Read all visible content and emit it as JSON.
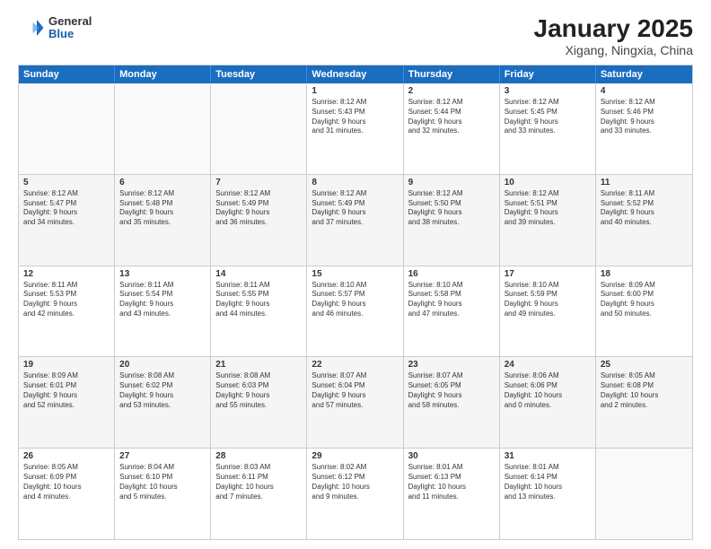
{
  "logo": {
    "general": "General",
    "blue": "Blue"
  },
  "title": "January 2025",
  "subtitle": "Xigang, Ningxia, China",
  "header_days": [
    "Sunday",
    "Monday",
    "Tuesday",
    "Wednesday",
    "Thursday",
    "Friday",
    "Saturday"
  ],
  "weeks": [
    {
      "alt": false,
      "days": [
        {
          "num": "",
          "info": ""
        },
        {
          "num": "",
          "info": ""
        },
        {
          "num": "",
          "info": ""
        },
        {
          "num": "1",
          "info": "Sunrise: 8:12 AM\nSunset: 5:43 PM\nDaylight: 9 hours\nand 31 minutes."
        },
        {
          "num": "2",
          "info": "Sunrise: 8:12 AM\nSunset: 5:44 PM\nDaylight: 9 hours\nand 32 minutes."
        },
        {
          "num": "3",
          "info": "Sunrise: 8:12 AM\nSunset: 5:45 PM\nDaylight: 9 hours\nand 33 minutes."
        },
        {
          "num": "4",
          "info": "Sunrise: 8:12 AM\nSunset: 5:46 PM\nDaylight: 9 hours\nand 33 minutes."
        }
      ]
    },
    {
      "alt": true,
      "days": [
        {
          "num": "5",
          "info": "Sunrise: 8:12 AM\nSunset: 5:47 PM\nDaylight: 9 hours\nand 34 minutes."
        },
        {
          "num": "6",
          "info": "Sunrise: 8:12 AM\nSunset: 5:48 PM\nDaylight: 9 hours\nand 35 minutes."
        },
        {
          "num": "7",
          "info": "Sunrise: 8:12 AM\nSunset: 5:49 PM\nDaylight: 9 hours\nand 36 minutes."
        },
        {
          "num": "8",
          "info": "Sunrise: 8:12 AM\nSunset: 5:49 PM\nDaylight: 9 hours\nand 37 minutes."
        },
        {
          "num": "9",
          "info": "Sunrise: 8:12 AM\nSunset: 5:50 PM\nDaylight: 9 hours\nand 38 minutes."
        },
        {
          "num": "10",
          "info": "Sunrise: 8:12 AM\nSunset: 5:51 PM\nDaylight: 9 hours\nand 39 minutes."
        },
        {
          "num": "11",
          "info": "Sunrise: 8:11 AM\nSunset: 5:52 PM\nDaylight: 9 hours\nand 40 minutes."
        }
      ]
    },
    {
      "alt": false,
      "days": [
        {
          "num": "12",
          "info": "Sunrise: 8:11 AM\nSunset: 5:53 PM\nDaylight: 9 hours\nand 42 minutes."
        },
        {
          "num": "13",
          "info": "Sunrise: 8:11 AM\nSunset: 5:54 PM\nDaylight: 9 hours\nand 43 minutes."
        },
        {
          "num": "14",
          "info": "Sunrise: 8:11 AM\nSunset: 5:55 PM\nDaylight: 9 hours\nand 44 minutes."
        },
        {
          "num": "15",
          "info": "Sunrise: 8:10 AM\nSunset: 5:57 PM\nDaylight: 9 hours\nand 46 minutes."
        },
        {
          "num": "16",
          "info": "Sunrise: 8:10 AM\nSunset: 5:58 PM\nDaylight: 9 hours\nand 47 minutes."
        },
        {
          "num": "17",
          "info": "Sunrise: 8:10 AM\nSunset: 5:59 PM\nDaylight: 9 hours\nand 49 minutes."
        },
        {
          "num": "18",
          "info": "Sunrise: 8:09 AM\nSunset: 6:00 PM\nDaylight: 9 hours\nand 50 minutes."
        }
      ]
    },
    {
      "alt": true,
      "days": [
        {
          "num": "19",
          "info": "Sunrise: 8:09 AM\nSunset: 6:01 PM\nDaylight: 9 hours\nand 52 minutes."
        },
        {
          "num": "20",
          "info": "Sunrise: 8:08 AM\nSunset: 6:02 PM\nDaylight: 9 hours\nand 53 minutes."
        },
        {
          "num": "21",
          "info": "Sunrise: 8:08 AM\nSunset: 6:03 PM\nDaylight: 9 hours\nand 55 minutes."
        },
        {
          "num": "22",
          "info": "Sunrise: 8:07 AM\nSunset: 6:04 PM\nDaylight: 9 hours\nand 57 minutes."
        },
        {
          "num": "23",
          "info": "Sunrise: 8:07 AM\nSunset: 6:05 PM\nDaylight: 9 hours\nand 58 minutes."
        },
        {
          "num": "24",
          "info": "Sunrise: 8:06 AM\nSunset: 6:06 PM\nDaylight: 10 hours\nand 0 minutes."
        },
        {
          "num": "25",
          "info": "Sunrise: 8:05 AM\nSunset: 6:08 PM\nDaylight: 10 hours\nand 2 minutes."
        }
      ]
    },
    {
      "alt": false,
      "days": [
        {
          "num": "26",
          "info": "Sunrise: 8:05 AM\nSunset: 6:09 PM\nDaylight: 10 hours\nand 4 minutes."
        },
        {
          "num": "27",
          "info": "Sunrise: 8:04 AM\nSunset: 6:10 PM\nDaylight: 10 hours\nand 5 minutes."
        },
        {
          "num": "28",
          "info": "Sunrise: 8:03 AM\nSunset: 6:11 PM\nDaylight: 10 hours\nand 7 minutes."
        },
        {
          "num": "29",
          "info": "Sunrise: 8:02 AM\nSunset: 6:12 PM\nDaylight: 10 hours\nand 9 minutes."
        },
        {
          "num": "30",
          "info": "Sunrise: 8:01 AM\nSunset: 6:13 PM\nDaylight: 10 hours\nand 11 minutes."
        },
        {
          "num": "31",
          "info": "Sunrise: 8:01 AM\nSunset: 6:14 PM\nDaylight: 10 hours\nand 13 minutes."
        },
        {
          "num": "",
          "info": ""
        }
      ]
    }
  ]
}
